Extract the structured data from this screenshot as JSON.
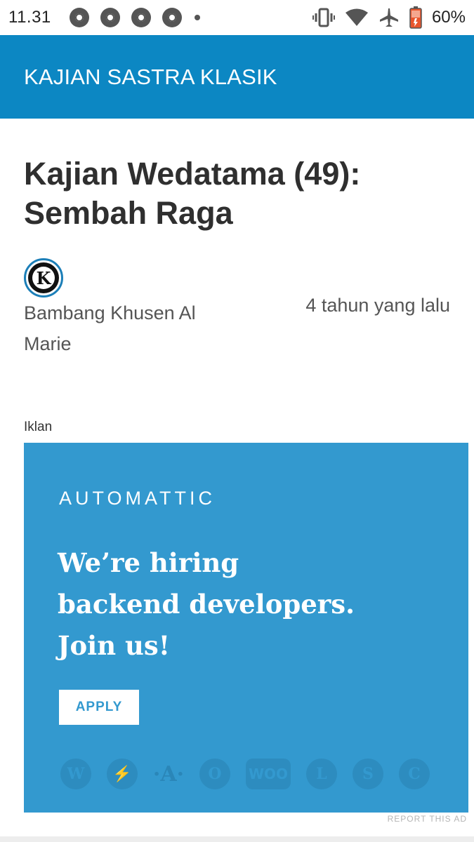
{
  "status_bar": {
    "time": "11.31",
    "battery": "60%",
    "icons": [
      "chrome-icon",
      "chrome-icon",
      "chrome-icon",
      "chrome-icon",
      "notification-dot-icon",
      "vibrate-icon",
      "wifi-icon",
      "airplane-mode-icon",
      "battery-icon"
    ]
  },
  "app_bar": {
    "title": "KAJIAN SASTRA KLASIK"
  },
  "article": {
    "title": "Kajian Wedatama (49): Sembah Raga",
    "avatar_letter": "K",
    "author": "Bambang Khusen Al Marie",
    "date": "4 tahun yang lalu"
  },
  "ad": {
    "label": "Iklan",
    "brand": "AUTOMATTIC",
    "headline": [
      "We’re hiring",
      "backend developers.",
      "Join us!"
    ],
    "apply_label": "APPLY",
    "product_icons": [
      {
        "name": "wordpress-icon",
        "glyph": "W"
      },
      {
        "name": "jetpack-icon",
        "glyph": "⚡"
      },
      {
        "name": "akismet-icon",
        "glyph": "·A·"
      },
      {
        "name": "simplenote-icon",
        "glyph": "O"
      },
      {
        "name": "woocommerce-icon",
        "glyph": "WOO"
      },
      {
        "name": "longreads-icon",
        "glyph": "L"
      },
      {
        "name": "simplenote-s-icon",
        "glyph": "S"
      },
      {
        "name": "crowdsignal-icon",
        "glyph": "C"
      }
    ],
    "report_label": "REPORT THIS AD"
  },
  "colors": {
    "app_bar": "#0c87c3",
    "ad_background": "#3399cf"
  }
}
